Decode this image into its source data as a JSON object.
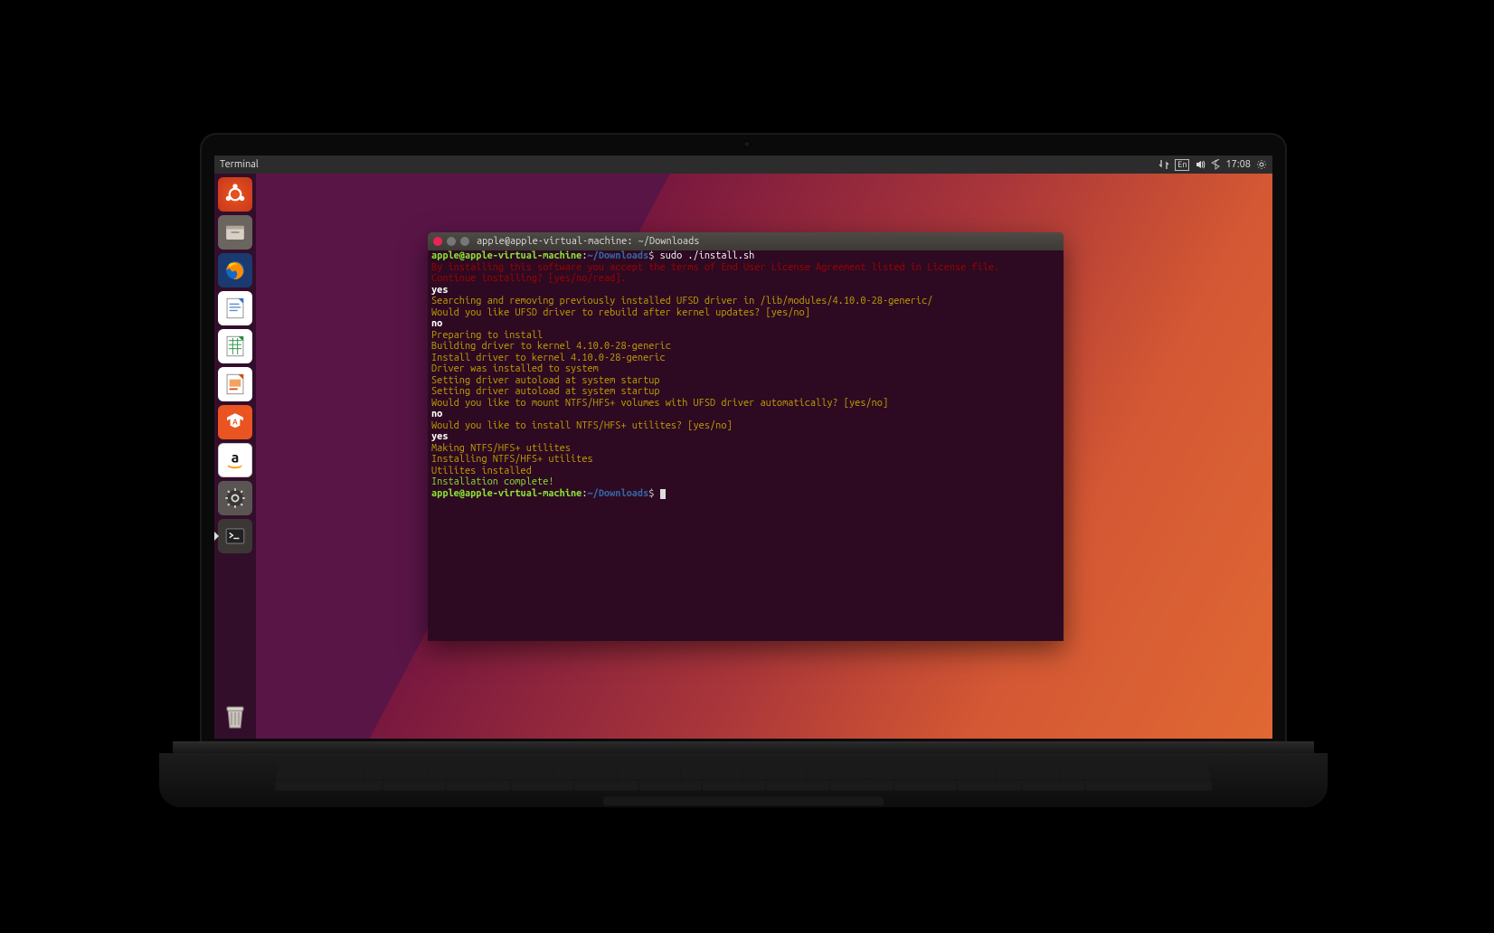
{
  "topbar": {
    "app": "Terminal",
    "lang": "En",
    "time": "17:08"
  },
  "launcher": [
    {
      "name": "dash",
      "label": "Dash"
    },
    {
      "name": "files",
      "label": "Files"
    },
    {
      "name": "firefox",
      "label": "Firefox"
    },
    {
      "name": "writer",
      "label": "LibreOffice Writer"
    },
    {
      "name": "calc",
      "label": "LibreOffice Calc"
    },
    {
      "name": "impress",
      "label": "LibreOffice Impress"
    },
    {
      "name": "software",
      "label": "Ubuntu Software"
    },
    {
      "name": "amazon",
      "label": "Amazon"
    },
    {
      "name": "settings",
      "label": "System Settings"
    },
    {
      "name": "terminal",
      "label": "Terminal"
    }
  ],
  "window": {
    "title": "apple@apple-virtual-machine: ~/Downloads"
  },
  "prompt": {
    "userhost": "apple@apple-virtual-machine",
    "sep": ":",
    "path": "~/Downloads",
    "sigil": "$"
  },
  "lines": [
    {
      "type": "input",
      "text": "sudo ./install.sh"
    },
    {
      "type": "red",
      "text": "By installing this software you accept the terms of End User License Agreement listed in License file."
    },
    {
      "type": "red",
      "text": "Continue installing? [yes/no/read]."
    },
    {
      "type": "white",
      "text": "yes"
    },
    {
      "type": "yel",
      "text": "Searching and removing previously installed UFSD driver in /lib/modules/4.10.0-28-generic/"
    },
    {
      "type": "yel",
      "text": "Would you like UFSD driver to rebuild after kernel updates? [yes/no]"
    },
    {
      "type": "white",
      "text": "no"
    },
    {
      "type": "yel",
      "text": "Preparing to install"
    },
    {
      "type": "yel",
      "text": "Building driver to kernel 4.10.0-28-generic"
    },
    {
      "type": "yel",
      "text": "Install driver to kernel 4.10.0-28-generic"
    },
    {
      "type": "yel",
      "text": "Driver was installed to system"
    },
    {
      "type": "yel",
      "text": "Setting driver autoload at system startup"
    },
    {
      "type": "yel",
      "text": "Setting driver autoload at system startup"
    },
    {
      "type": "yel",
      "text": "Would you like to mount NTFS/HFS+ volumes with UFSD driver automatically? [yes/no]"
    },
    {
      "type": "white",
      "text": "no"
    },
    {
      "type": "yel",
      "text": "Would you like to install NTFS/HFS+ utilites? [yes/no]"
    },
    {
      "type": "white",
      "text": "yes"
    },
    {
      "type": "yel",
      "text": "Making NTFS/HFS+ utilites"
    },
    {
      "type": "yel",
      "text": "Installing NTFS/HFS+ utilites"
    },
    {
      "type": "yel",
      "text": "Utilites installed"
    },
    {
      "type": "green",
      "text": "Installation complete!"
    },
    {
      "type": "prompt"
    }
  ]
}
